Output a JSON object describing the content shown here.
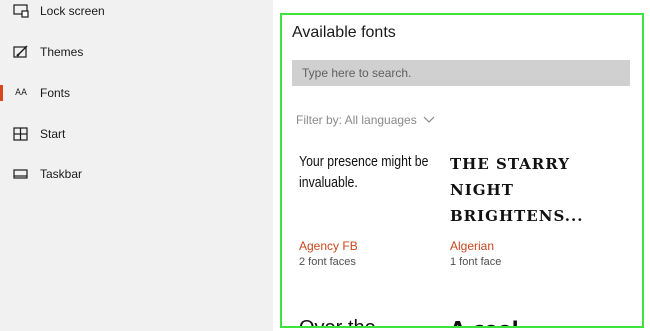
{
  "sidebar": {
    "items": [
      {
        "label": "Lock screen",
        "icon": "lock-screen-icon",
        "active": false
      },
      {
        "label": "Themes",
        "icon": "themes-icon",
        "active": false
      },
      {
        "label": "Fonts",
        "icon": "fonts-icon",
        "active": true,
        "icon_text": "AA"
      },
      {
        "label": "Start",
        "icon": "start-icon",
        "active": false
      },
      {
        "label": "Taskbar",
        "icon": "taskbar-icon",
        "active": false
      }
    ]
  },
  "main": {
    "title": "Available fonts",
    "search": {
      "placeholder": "Type here to search.",
      "value": ""
    },
    "filter": {
      "label": "Filter by: All languages",
      "icon": "chevron-down-icon"
    },
    "fonts": [
      {
        "preview": "Your presence might be invaluable.",
        "name": "Agency FB",
        "faces": "2 font faces"
      },
      {
        "preview": "THE STARRY NIGHT BRIGHTENS...",
        "name": "Algerian",
        "faces": "1 font face"
      }
    ],
    "partial_previews": [
      "Over the",
      "A cool"
    ]
  },
  "colors": {
    "accent": "#d9481c",
    "font_name": "#c8471d",
    "highlight_border": "#3ee43e",
    "sidebar_bg": "#f1f1f1",
    "search_bg": "#d0d0d0"
  }
}
